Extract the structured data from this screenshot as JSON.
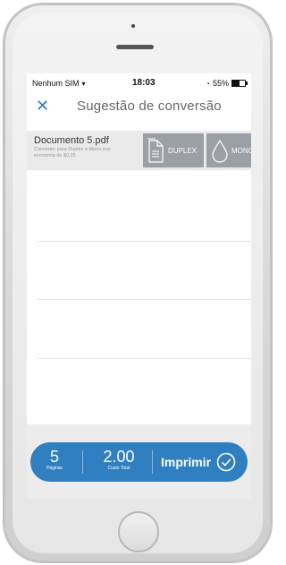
{
  "status_bar": {
    "carrier": "Nenhum SIM",
    "time": "18:03",
    "battery": "55%"
  },
  "navbar": {
    "title": "Sugestão de conversão"
  },
  "suggestion": {
    "document_name": "Documento 5.pdf",
    "description": "Converter para Duplex e Mono traz economia de $0,95",
    "options": [
      {
        "label": "DUPLEX",
        "icon": "duplex-page-icon"
      },
      {
        "label": "MONO",
        "icon": "ink-drop-icon"
      }
    ]
  },
  "summary": {
    "pages_value": "5",
    "pages_label": "Páginas",
    "cost_value": "2.00",
    "cost_label": "Custo Total",
    "print_label": "Imprimir"
  },
  "colors": {
    "accent": "#2f7fc1",
    "option_bg": "#9aa0a5",
    "row_bg": "#eaeaea"
  }
}
